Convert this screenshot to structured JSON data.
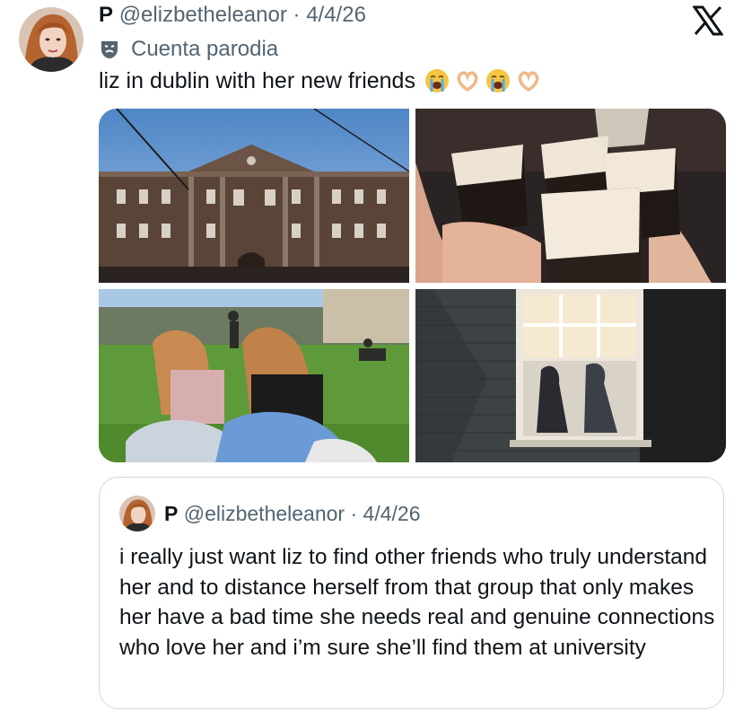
{
  "tweet": {
    "author_name": "P",
    "handle": "@elizbetheleanor",
    "separator": "·",
    "date": "4/4/26",
    "parody_label": "Cuenta parodia",
    "text": "liz in dublin with her new friends",
    "emojis": [
      "loudly-crying-face",
      "heart-hands",
      "loudly-crying-face",
      "heart-hands"
    ]
  },
  "media": {
    "photos": [
      "trinity-college-building",
      "pints-cheers",
      "friends-on-lawn",
      "window-at-night"
    ]
  },
  "quoted_tweet": {
    "author_name": "P",
    "handle": "@elizbetheleanor",
    "separator": "·",
    "date": "4/4/26",
    "text": "i really just want liz to find other friends who truly understand her and to distance herself from that group that only makes her have a bad time she needs real and genuine connections who love her and i’m sure she’ll find them at university"
  },
  "colors": {
    "text": "#0f1419",
    "muted": "#536471",
    "border": "#cfd9de"
  }
}
